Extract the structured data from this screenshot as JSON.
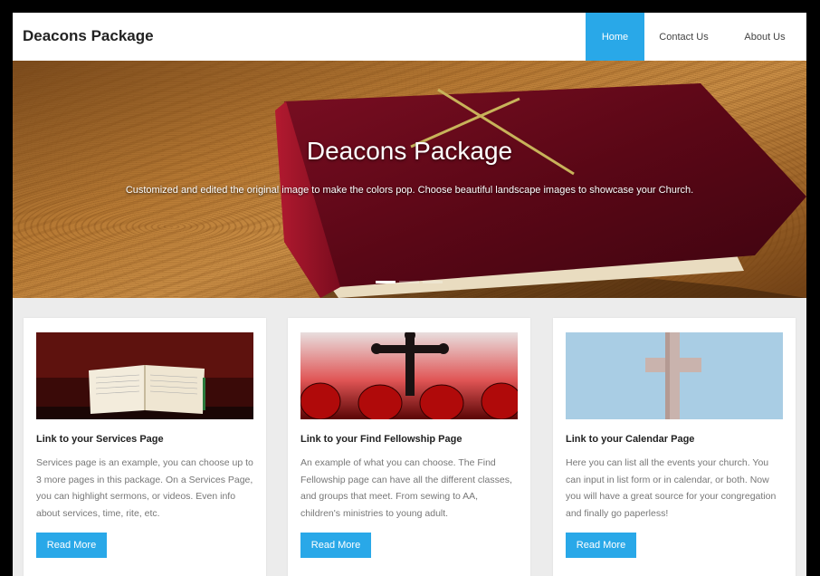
{
  "header": {
    "brand": "Deacons Package",
    "nav": [
      {
        "label": "Home",
        "active": true
      },
      {
        "label": "Contact Us",
        "active": false
      },
      {
        "label": "About Us",
        "active": false
      }
    ]
  },
  "hero": {
    "title": "Deacons Package",
    "subtitle": "Customized and edited the original image to make the colors pop. Choose beautiful landscape images to showcase your Church.",
    "slides": 4,
    "active_slide": 1
  },
  "cards": [
    {
      "title": "Link to your Services Page",
      "text": "Services page is an example, you can choose up to 3 more pages in this package. On a Services Page, you can highlight sermons, or videos. Even info about services, time, rite, etc.",
      "button": "Read More"
    },
    {
      "title": "Link to your Find Fellowship Page",
      "text": "An example of what you can choose. The Find Fellowship page can have all the different classes, and groups that meet. From sewing to AA, children's ministries to young adult.",
      "button": "Read More"
    },
    {
      "title": "Link to your Calendar Page",
      "text": "Here you can list all the events your church. You can input in list form or in calendar, or both. Now you will have a great source for your congregation and finally go paperless!",
      "button": "Read More"
    }
  ],
  "colors": {
    "accent": "#29a8e8",
    "header_bg": "#ffffff",
    "page_bg": "#ececec"
  }
}
